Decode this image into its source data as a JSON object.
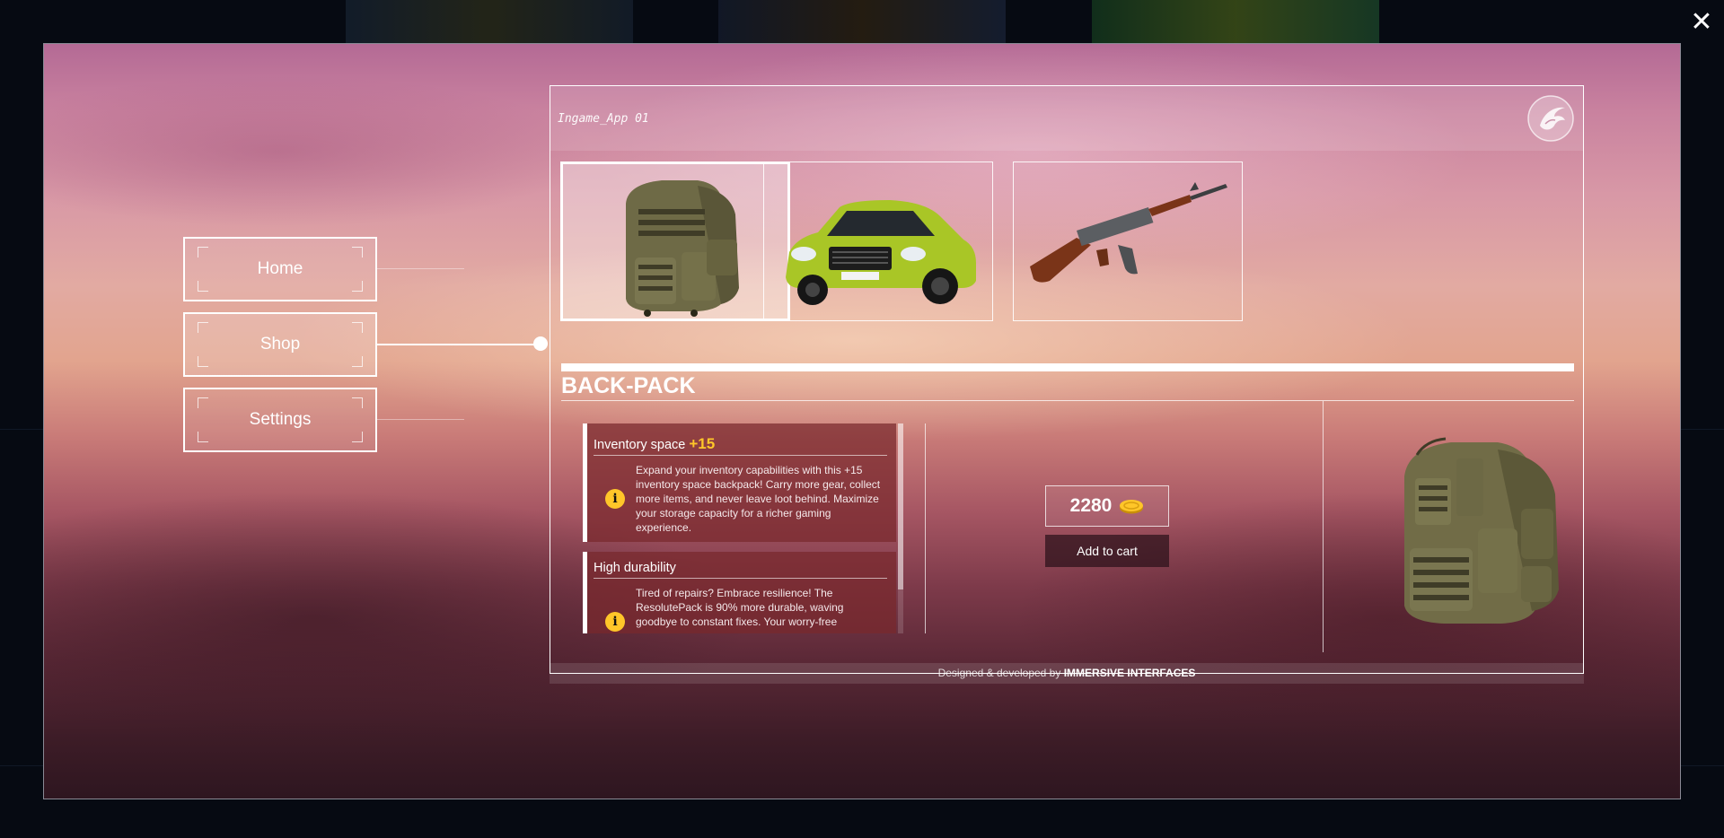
{
  "window": {
    "close_symbol": "✕"
  },
  "nav": {
    "items": [
      {
        "label": "Home",
        "active": false
      },
      {
        "label": "Shop",
        "active": true
      },
      {
        "label": "Settings",
        "active": false
      }
    ]
  },
  "app": {
    "title": "Ingame_App 01",
    "logo_icon": "phoenix-logo-icon"
  },
  "shop": {
    "items": [
      {
        "name": "backpack",
        "icon": "backpack-icon",
        "selected": true
      },
      {
        "name": "car",
        "icon": "car-icon",
        "selected": false
      },
      {
        "name": "rifle",
        "icon": "rifle-icon",
        "selected": false
      }
    ],
    "selected_name": "BACK-PACK",
    "features": [
      {
        "title": "Inventory space",
        "bonus": "+15",
        "description": "Expand your inventory capabilities with this +15 inventory space backpack! Carry more gear, collect more items, and never leave loot behind. Maximize your storage capacity for a richer gaming experience."
      },
      {
        "title": "High durability",
        "bonus": "",
        "description": "Tired of repairs? Embrace resilience! The ResolutePack is 90% more durable, waving goodbye to constant fixes. Your worry-free"
      }
    ],
    "price": "2280",
    "currency_icon": "coin-icon",
    "add_to_cart_label": "Add to cart"
  },
  "footer": {
    "prefix": "Designed & developed by",
    "brand": "IMMERSIVE INTERFACES"
  },
  "colors": {
    "accent": "#ffc629",
    "border": "#ffffff"
  }
}
